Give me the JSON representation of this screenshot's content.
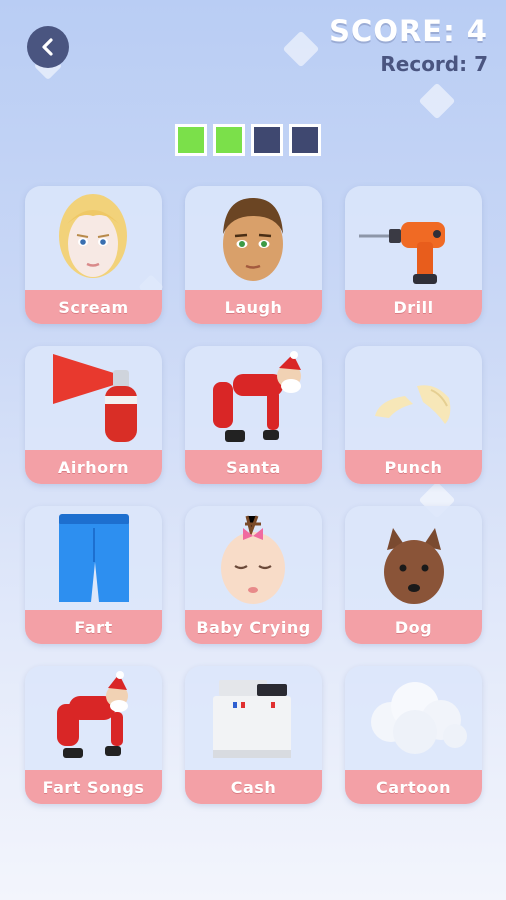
{
  "header": {
    "score_text": "SCORE: 4",
    "record_text": "Record: 7"
  },
  "progress": {
    "filled": 2,
    "total": 4,
    "filled_color": "#7be04a",
    "empty_color": "#3f4870"
  },
  "cards": [
    {
      "label": "Scream",
      "icon": "blonde-woman-face"
    },
    {
      "label": "Laugh",
      "icon": "man-face"
    },
    {
      "label": "Drill",
      "icon": "power-drill"
    },
    {
      "label": "Airhorn",
      "icon": "airhorn"
    },
    {
      "label": "Santa",
      "icon": "santa-bending"
    },
    {
      "label": "Punch",
      "icon": "punching-hands"
    },
    {
      "label": "Fart",
      "icon": "blue-pants"
    },
    {
      "label": "Baby Crying",
      "icon": "baby-face"
    },
    {
      "label": "Dog",
      "icon": "dog-head"
    },
    {
      "label": "Fart Songs",
      "icon": "santa-crouching"
    },
    {
      "label": "Cash",
      "icon": "cash-register"
    },
    {
      "label": "Cartoon",
      "icon": "cloud-puff"
    }
  ],
  "colors": {
    "label_bg": "#f3a0a6",
    "button_bg": "#4a5580"
  }
}
